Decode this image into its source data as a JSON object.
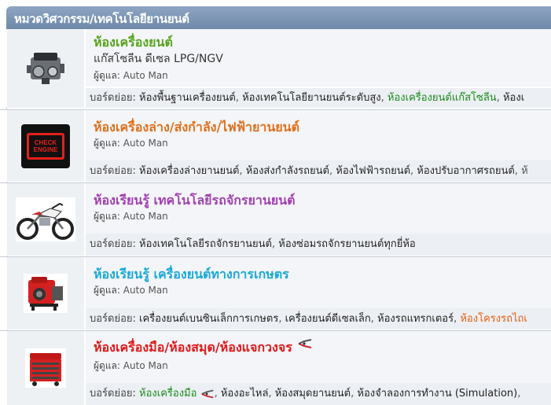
{
  "category": {
    "title": "หมวดวิศวกรรม/เทคโนโลยียานยนต์"
  },
  "forums": [
    {
      "title": "ห้องเครื่องยนต์",
      "title_color": "#56a41c",
      "description": "แก๊สโซลีน ดีเซล LPG/NGV",
      "moderator_label": "ผู้ดูแล:",
      "moderator": "Auto Man",
      "subs_label": "บอร์ดย่อย:",
      "subforums": [
        {
          "label": "ห้องพื้นฐานเครื่องยนต์",
          "style": ""
        },
        {
          "label": "ห้องเทคโนโลยียานยนต์ระดับสูง",
          "style": ""
        },
        {
          "label": "ห้องเครื่องยนต์แก๊สโซลีน",
          "style": "green"
        },
        {
          "label": "ห้องเ",
          "style": ""
        }
      ],
      "icon": "engine-icon"
    },
    {
      "title": "ห้องเครื่องล่าง/ส่งกำลัง/ไฟฟ้ายานยนต์",
      "title_color": "#e0701c",
      "moderator_label": "ผู้ดูแล:",
      "moderator": "Auto Man",
      "subs_label": "บอร์ดย่อย:",
      "subforums": [
        {
          "label": "ห้องเครื่องล่างยานยนต์",
          "style": ""
        },
        {
          "label": "ห้องส่งกำลังรถยนต์",
          "style": ""
        },
        {
          "label": "ห้องไฟฟ้ารถยนต์",
          "style": ""
        },
        {
          "label": "ห้องปรับอากาศรถยนต์",
          "style": ""
        }
      ],
      "icon": "check-engine-icon",
      "icon_text": "CHECK ENGINE"
    },
    {
      "title": "ห้องเรียนรู้ เทคโนโลยีรถจักรยานยนต์",
      "title_color": "#a040b0",
      "moderator_label": "ผู้ดูแล:",
      "moderator": "Auto Man",
      "subs_label": "บอร์ดย่อย:",
      "subforums": [
        {
          "label": "ห้องเทคโนโลยีรถจักรยานยนต์",
          "style": ""
        },
        {
          "label": "ห้องซ่อมรถจักรยานยนต์ทุกยี่ห้อ",
          "style": ""
        }
      ],
      "icon": "motorcycle-icon"
    },
    {
      "title": "ห้องเรียนรู้ เครื่องยนต์ทางการเกษตร",
      "title_color": "#18a8d8",
      "moderator_label": "ผู้ดูแล:",
      "moderator": "Auto Man",
      "subs_label": "บอร์ดย่อย:",
      "subforums": [
        {
          "label": "เครื่องยนต์เบนซินเล็กการเกษตร",
          "style": ""
        },
        {
          "label": "เครื่องยนต์ดีเซลเล็ก",
          "style": ""
        },
        {
          "label": "ห้องรถแทรกเตอร์",
          "style": ""
        },
        {
          "label": "ห้องโครงรถไถเ",
          "style": "orange"
        }
      ],
      "icon": "generator-icon"
    },
    {
      "title": "ห้องเครื่องมือ/ห้องสมุด/ห้องแจกวงจร",
      "title_color": "#e01818",
      "moderator_label": "ผู้ดูแล:",
      "moderator": "Auto Man",
      "subs_label": "บอร์ดย่อย:",
      "subforums": [
        {
          "label": "ห้องเครื่องมือ",
          "style": "green",
          "icon": "pliers-icon"
        },
        {
          "label": "ห้องอะไหล่",
          "style": ""
        },
        {
          "label": "ห้องสมุดยานยนต์",
          "style": ""
        },
        {
          "label": "ห้องจำลองการทำงาน (Simulation)",
          "style": ""
        }
      ],
      "icon": "toolbox-icon"
    }
  ]
}
